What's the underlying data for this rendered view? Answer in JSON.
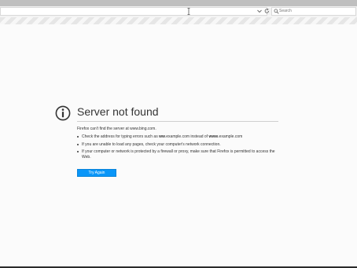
{
  "toolbar": {
    "search_placeholder": "Search",
    "icons": {
      "cursor": "text-cursor-icon",
      "dropdown": "chevron-down-icon",
      "reload": "reload-icon",
      "search": "search-icon"
    }
  },
  "error": {
    "icon": "info-icon",
    "title": "Server not found",
    "description": "Firefox can't find the server at www.bing.com.",
    "bullets": [
      {
        "before": "Check the address for typing errors such as ",
        "bold1": "ww",
        "middle": ".example.com instead of ",
        "bold2": "www",
        "after": ".example.com"
      },
      {
        "text": "If you are unable to load any pages, check your computer's network connection."
      },
      {
        "text": "If your computer or network is protected by a firewall or proxy, make sure that Firefox is permitted to access the Web."
      }
    ],
    "button_label": "Try Again"
  },
  "colors": {
    "accent": "#0996f8",
    "text": "#333333"
  }
}
